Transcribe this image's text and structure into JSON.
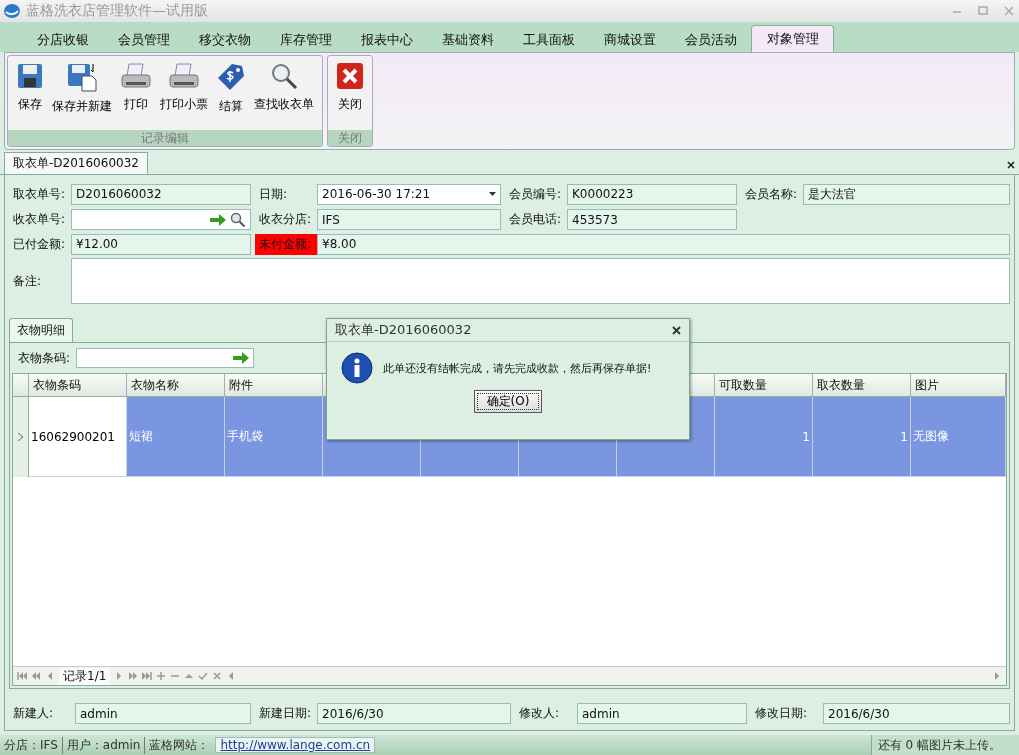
{
  "window": {
    "title": "蓝格洗衣店管理软件—试用版"
  },
  "menu_tabs": [
    {
      "label": "分店收银",
      "selected": false
    },
    {
      "label": "会员管理",
      "selected": false
    },
    {
      "label": "移交衣物",
      "selected": false
    },
    {
      "label": "库存管理",
      "selected": false
    },
    {
      "label": "报表中心",
      "selected": false
    },
    {
      "label": "基础资料",
      "selected": false
    },
    {
      "label": "工具面板",
      "selected": false
    },
    {
      "label": "商城设置",
      "selected": false
    },
    {
      "label": "会员活动",
      "selected": false
    },
    {
      "label": "对象管理",
      "selected": true
    }
  ],
  "ribbon": {
    "groups": [
      {
        "label": "记录编辑",
        "buttons": [
          {
            "label": "保存"
          },
          {
            "label": "保存并新建"
          },
          {
            "label": "打印"
          },
          {
            "label": "打印小票"
          },
          {
            "label": "结算"
          },
          {
            "label": "查找收衣单"
          }
        ]
      },
      {
        "label": "关闭",
        "buttons": [
          {
            "label": "关闭"
          }
        ]
      }
    ]
  },
  "document_tab": {
    "label": "取衣单-D2016060032"
  },
  "form": {
    "rows": [
      [
        {
          "label": "取衣单号:",
          "value": "D2016060032",
          "kind": "text",
          "alert": false
        },
        {
          "label": "日期:",
          "value": "2016-06-30 17:21",
          "kind": "date",
          "alert": false
        },
        {
          "label": "会员编号:",
          "value": "K0000223",
          "kind": "text",
          "alert": false
        },
        {
          "label": "会员名称:",
          "value": "是大法官",
          "kind": "text",
          "alert": false
        }
      ],
      [
        {
          "label": "收衣单号:",
          "kind": "lookup",
          "alert": false
        },
        {
          "label": "收衣分店:",
          "value": "IFS",
          "kind": "text",
          "alert": false
        },
        {
          "label": "会员电话:",
          "value": "453573",
          "kind": "text",
          "alert": false
        }
      ],
      [
        {
          "label": "已付金额:",
          "value": "¥12.00",
          "kind": "text",
          "alert": false
        },
        {
          "label": "未付金额:",
          "value": "¥8.00",
          "kind": "text",
          "alert": true
        }
      ],
      [
        {
          "label": "备注:",
          "kind": "memo",
          "alert": false
        }
      ]
    ]
  },
  "detail": {
    "tab": "衣物明细",
    "barcode_label": "衣物条码:",
    "columns": [
      "衣物条码",
      "衣物名称",
      "附件",
      null,
      null,
      null,
      null,
      "可取数量",
      "取衣数量",
      "图片"
    ],
    "rows": [
      {
        "selected": true,
        "cells": [
          "16062900201",
          "短裙",
          "手机袋",
          null,
          null,
          null,
          null,
          "1",
          "1",
          "无图像"
        ]
      }
    ],
    "navigator": "记录1/1"
  },
  "audit": [
    {
      "label": "新建人:",
      "value": "admin"
    },
    {
      "label": "新建日期:",
      "value": "2016/6/30"
    },
    {
      "label": "修改人:",
      "value": "admin"
    },
    {
      "label": "修改日期:",
      "value": "2016/6/30"
    }
  ],
  "status_bar": {
    "items": [
      "分店：IFS",
      "用户：admin",
      "蓝格网站："
    ],
    "link": "http://www.lange.com.cn",
    "right": "还有 0 幅图片未上传。"
  },
  "dialog": {
    "title": "取衣单-D2016060032",
    "message": "此单还没有结帐完成，请先完成收款，然后再保存单据!",
    "button": "确定(O)"
  }
}
